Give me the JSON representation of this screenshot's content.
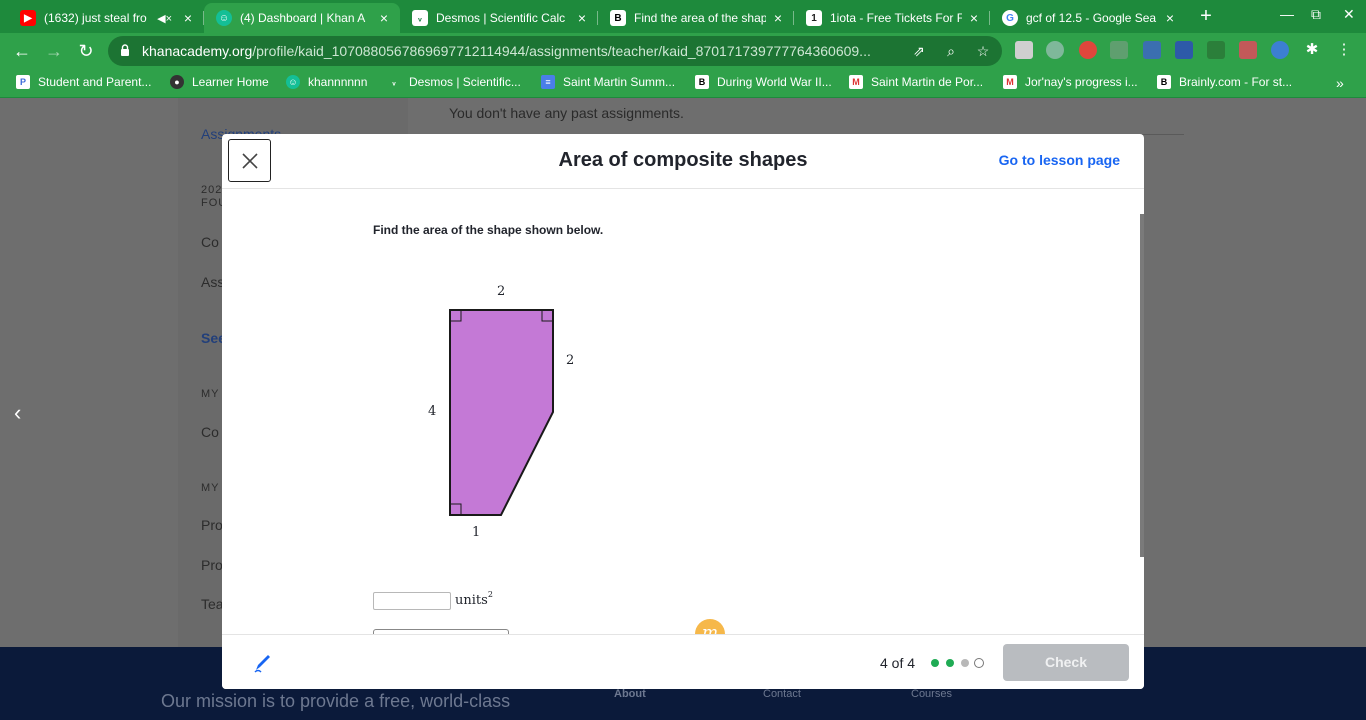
{
  "browser": {
    "tabs": [
      {
        "title": "(1632) just steal fro",
        "icon": "youtube-icon",
        "color": "#ff0000",
        "muted": true
      },
      {
        "title": "(4) Dashboard | Khan A",
        "icon": "khan-academy-icon",
        "color": "#14bf96",
        "active": true
      },
      {
        "title": "Desmos | Scientific Calc",
        "icon": "desmos-icon",
        "color": "#127a3e"
      },
      {
        "title": "Find the area of the shap",
        "icon": "brainly-icon",
        "color": "#000000"
      },
      {
        "title": "1iota - Free Tickets For F",
        "icon": "iota-icon",
        "color": "#222222"
      },
      {
        "title": "gcf of 12.5 - Google Sea",
        "icon": "google-icon",
        "color": "#ffffff"
      }
    ],
    "url_host": "khanacademy.org",
    "url_path": "/profile/kaid_1070880567869697712114944/assignments/teacher/kaid_870171739777764360609...",
    "bookmarks": [
      {
        "label": "Student and Parent...",
        "icon": "parentsquare-icon"
      },
      {
        "label": "Learner Home",
        "icon": "learner-home-icon"
      },
      {
        "label": "khannnnnn",
        "icon": "khan-academy-icon"
      },
      {
        "label": "Desmos | Scientific...",
        "icon": "desmos-icon"
      },
      {
        "label": "Saint Martin Summ...",
        "icon": "google-docs-icon"
      },
      {
        "label": "During World War II...",
        "icon": "brainly-icon"
      },
      {
        "label": "Saint Martin de Por...",
        "icon": "gmail-icon"
      },
      {
        "label": "Jor'nay's progress i...",
        "icon": "gmail-icon"
      },
      {
        "label": "Brainly.com - For st...",
        "icon": "brainly-icon"
      }
    ]
  },
  "background_page": {
    "sidebar_active": "Assignments",
    "sidebar_date": "202",
    "sidebar_date2": "FOU",
    "sidebar_items": [
      "Co",
      "Ass",
      "See",
      "MY",
      "Co",
      "MY",
      "Pro",
      "Pro",
      "Tea"
    ],
    "past_assignments": "You don't have any past assignments.",
    "footer_mission": "Our mission is to provide a free, world-class",
    "footer_links": [
      "About",
      "Contact",
      "Courses"
    ]
  },
  "modal": {
    "title": "Area of composite shapes",
    "lesson_link": "Go to lesson page",
    "question": "Find the area of the shape shown below.",
    "figure": {
      "fill_color": "#c479d6",
      "labels": {
        "top": "2",
        "right": "2",
        "left": "4",
        "bottom": "1"
      }
    },
    "answer": {
      "value": "",
      "units": "units",
      "exponent": "2"
    },
    "progress_text": "4 of 4",
    "progress_dots": [
      "complete",
      "complete",
      "incomplete",
      "current"
    ],
    "check_label": "Check",
    "accent": "#1865f2"
  }
}
